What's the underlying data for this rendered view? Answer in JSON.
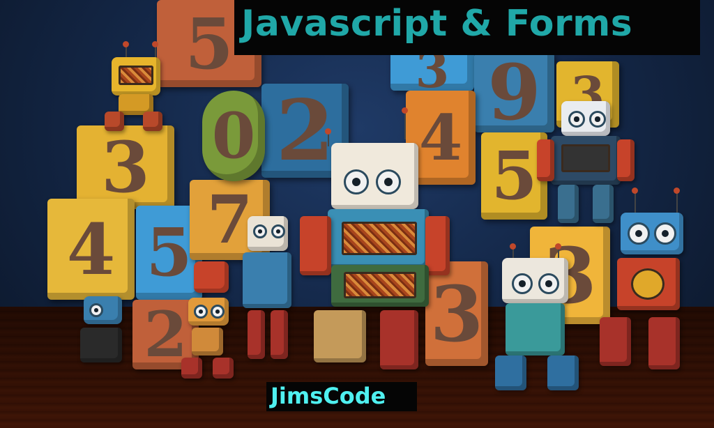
{
  "title": "Javascript & Forms",
  "brand": "JimsCode",
  "colors": {
    "title_text": "#20a8a8",
    "brand_text": "#4ff0f0",
    "label_background": "#050505"
  },
  "blocks": [
    {
      "glyph": "5",
      "color": "#c0603a"
    },
    {
      "glyph": "3",
      "color": "#3f9bd6"
    },
    {
      "glyph": "9",
      "color": "#3a7fae"
    },
    {
      "glyph": "2",
      "color": "#2d6e9e"
    },
    {
      "glyph": "3",
      "color": "#e2b52e"
    },
    {
      "glyph": "4",
      "color": "#e0832e"
    },
    {
      "glyph": "5",
      "color": "#e2b52e"
    },
    {
      "glyph": "3",
      "color": "#f0b53a"
    },
    {
      "glyph": "3",
      "color": "#e4b232"
    },
    {
      "glyph": "4",
      "color": "#e6b83a"
    },
    {
      "glyph": "5",
      "color": "#3f9bd6"
    },
    {
      "glyph": "7",
      "color": "#e2a13a"
    },
    {
      "glyph": "2",
      "color": "#c0603a"
    },
    {
      "glyph": "3",
      "color": "#d0703a"
    },
    {
      "glyph": "0",
      "color": "#7a9a3a"
    }
  ]
}
